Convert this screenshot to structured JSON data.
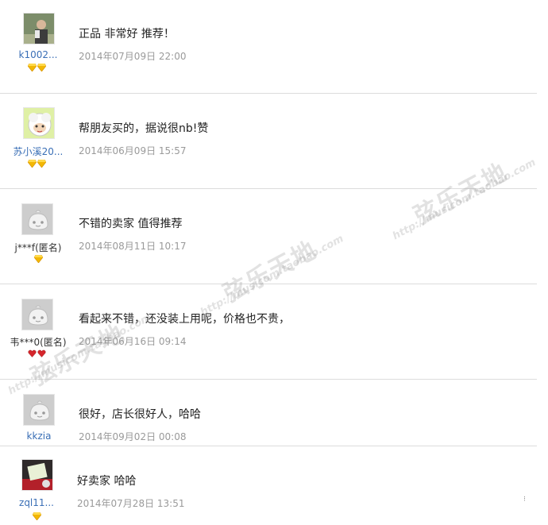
{
  "reviews": [
    {
      "username": "k1002...",
      "comment": "正品 非常好 推荐！",
      "date": "2014年07月09日 22:00",
      "badge_type": "diamond",
      "badge_count": 2,
      "avatar": "photo-avatar"
    },
    {
      "username": "苏小溪20...",
      "comment": "帮朋友买的，据说很nb!赞",
      "date": "2014年06月09日 15:57",
      "badge_type": "diamond",
      "badge_count": 2,
      "avatar": "cartoon-sheep-avatar"
    },
    {
      "username": "j***f(匿名)",
      "comment": "不错的卖家 值得推荐",
      "date": "2014年08月11日 10:17",
      "badge_type": "diamond",
      "badge_count": 1,
      "avatar": "default-avatar"
    },
    {
      "username": "韦***0(匿名)",
      "comment": "看起来不错，还没装上用呢，价格也不贵，",
      "date": "2014年06月16日 09:14",
      "badge_type": "heart",
      "badge_count": 2,
      "avatar": "default-avatar"
    },
    {
      "username": "kkzia",
      "comment": "很好，店长很好人，哈哈",
      "date": "2014年09月02日 00:08",
      "badge_type": "none",
      "badge_count": 0,
      "avatar": "default-avatar"
    },
    {
      "username": "zql11...",
      "comment": "好卖家 哈哈",
      "date": "2014年07月28日 13:51",
      "badge_type": "diamond",
      "badge_count": 1,
      "avatar": "photo-avatar"
    }
  ],
  "watermark": {
    "brand": "弦乐天地",
    "url": "http://musicom.taobao.com"
  },
  "colors": {
    "username": "#3a6fb6",
    "date": "#9a9a9a",
    "divider": "#dcdcdc",
    "diamond": "#f2b705",
    "heart": "#d6262c"
  }
}
